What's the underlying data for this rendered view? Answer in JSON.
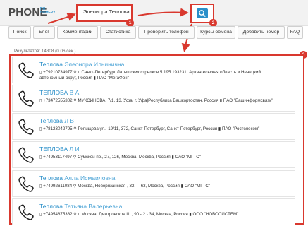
{
  "header": {
    "logo_text": "PHONE",
    "logo_sub_1": "ПО",
    "logo_sub_2": "НОМЕРУ",
    "search_value": "Элеонора Теплова",
    "search_icon": "search-icon"
  },
  "annotations": [
    "1",
    "2",
    "3"
  ],
  "nav": [
    "Поиск",
    "Блог",
    "Комментарии",
    "Статистика",
    "Проверить телефон",
    "Курсы обмена",
    "Добавить номер",
    "FAQ"
  ],
  "results_count": "Результатов: 14308 (0.06 сек.)",
  "results": [
    {
      "surname": "Теплова",
      "given": "Элеонора Ильинична",
      "detail": "▯ +79210734977 ⚲ г. Санкт-Петербург Латышских стрелков 5 195 193231, Архангельская область и Ненецкий автономный округ, Россия ▮ ПАО \"МегаФон\""
    },
    {
      "surname": "ТЕПЛОВА",
      "given": "В А",
      "detail": "▯ +73472555302 ⚲ МУКСИНОВА, 7/1, 13, Уфа, г. Уфа|Республика Башкортостан, Россия ▮ ПАО \"Башинформсвязь\""
    },
    {
      "surname": "Теплова",
      "given": "Л В",
      "detail": "▯ +78123042795 ⚲ Репищева ул., 19/11, 372, Санкт-Петербург, Санкт-Петербург, Россия ▮ ПАО \"Ростелеком\""
    },
    {
      "surname": "ТЕПЛОВА",
      "given": "Л И",
      "detail": "▯ +74953117497 ⚲ Сумской пр., 27, 126, Москва, Москва, Россия ▮ ОАО \"МГТС\""
    },
    {
      "surname": "Теплова",
      "given": "Алла Исмаиловна",
      "detail": "▯ +74992611084 ⚲ Москва, Новорязанская , 32 - - 63, Москва, Россия ▮ ОАО \"МГТС\""
    },
    {
      "surname": "Теплова",
      "given": "Татьяна Валерьевна",
      "detail": "▯ +74954875382 ⚲ г. Москва, Дмитровское Ш., 90 - 2 - 34, Москва, Россия ▮ ООО \"НОВОСИСТЕМ\""
    }
  ],
  "colors": {
    "annotation": "#d9382e",
    "link": "#2a8fc9",
    "topbar": "#f2f2f2"
  }
}
